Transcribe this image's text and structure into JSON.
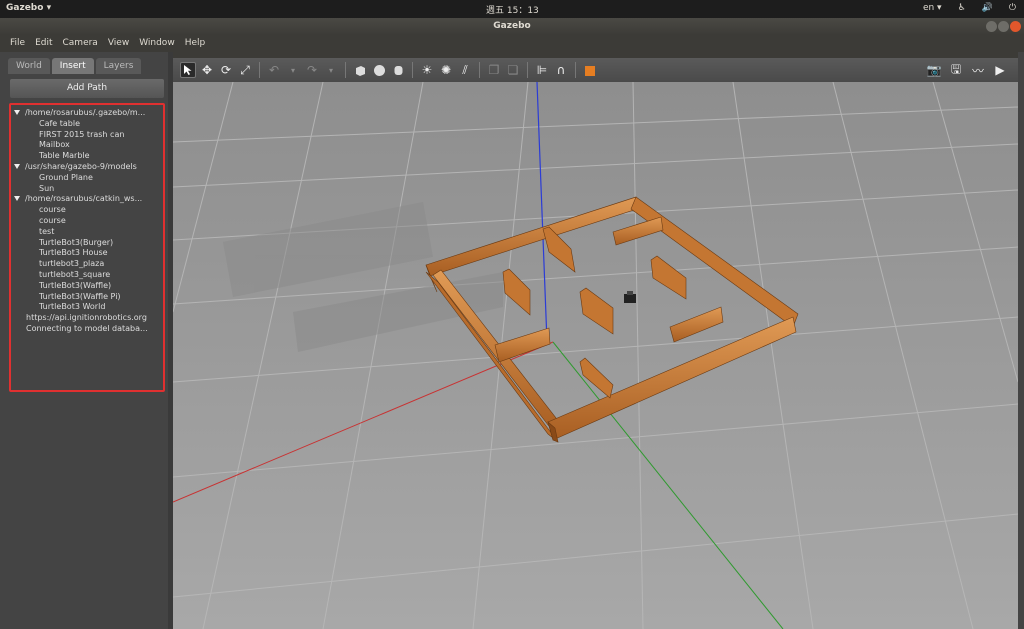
{
  "system_bar": {
    "app_name": "Gazebo",
    "clock": "週五 15：13",
    "language": "en"
  },
  "window": {
    "title": "Gazebo"
  },
  "menu": [
    "File",
    "Edit",
    "Camera",
    "View",
    "Window",
    "Help"
  ],
  "left_panel": {
    "tabs": [
      "World",
      "Insert",
      "Layers"
    ],
    "active_tab": "Insert",
    "add_path_label": "Add Path",
    "tree": {
      "group1": {
        "path": "/home/rosarubus/.gazebo/m...",
        "items": [
          "Cafe table",
          "FIRST 2015 trash can",
          "Mailbox",
          "Table Marble"
        ]
      },
      "group2": {
        "path": "/usr/share/gazebo-9/models",
        "items": [
          "Ground Plane",
          "Sun"
        ]
      },
      "group3": {
        "path": "/home/rosarubus/catkin_ws...",
        "items": [
          "course",
          "course",
          "test",
          "TurtleBot3(Burger)",
          "TurtleBot3 House",
          "turtlebot3_plaza",
          "turtlebot3_square",
          "TurtleBot3(Waffle)",
          "TurtleBot3(Waffle Pi)",
          "TurtleBot3 World"
        ]
      },
      "remote_db": "https://api.ignitionrobotics.org",
      "status": "Connecting to model databa..."
    }
  },
  "toolbar": {
    "icons": [
      "select-arrow-icon",
      "translate-icon",
      "rotate-icon",
      "scale-icon",
      "undo-icon",
      "redo-icon",
      "box-icon",
      "sphere-icon",
      "cylinder-icon",
      "point-light-icon",
      "spot-light-icon",
      "directional-light-icon",
      "copy-icon",
      "paste-icon",
      "align-icon",
      "snap-icon",
      "view-angle-icon",
      "screenshot-icon",
      "log-icon",
      "plot-icon",
      "record-video-icon"
    ]
  },
  "colors": {
    "highlight_border": "#e03030",
    "wood": "#c77a35",
    "ground": "#9c9c9c",
    "axis_x": "#d03030",
    "axis_y": "#30a030",
    "axis_z": "#3040d0"
  }
}
